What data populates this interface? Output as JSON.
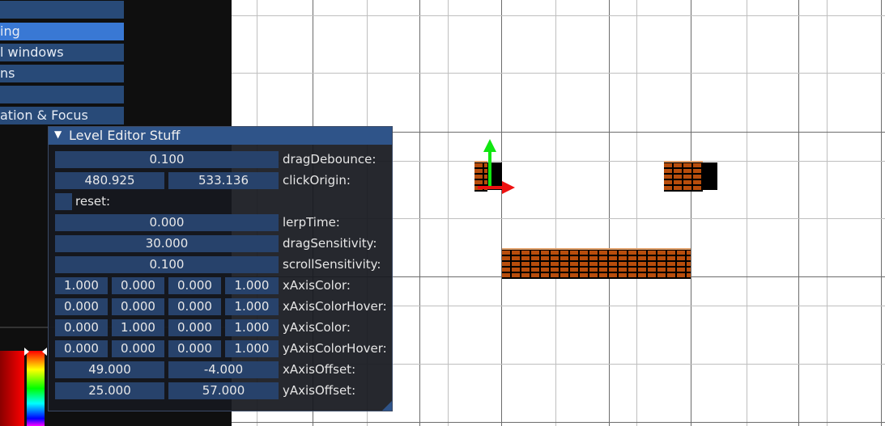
{
  "sidebar": {
    "items": [
      {
        "label": ""
      },
      {
        "label": "ing",
        "active": true
      },
      {
        "label": "l windows"
      },
      {
        "label": "ns"
      },
      {
        "label": ""
      },
      {
        "label": "ation & Focus"
      }
    ]
  },
  "editor": {
    "title": "Level Editor Stuff",
    "collapse_icon": "▼",
    "rows": {
      "dragDebounce": {
        "label": "dragDebounce:",
        "values": [
          "0.100"
        ]
      },
      "clickOrigin": {
        "label": "clickOrigin:",
        "values": [
          "480.925",
          "533.136"
        ]
      },
      "reset": {
        "label": "reset:",
        "checked": false
      },
      "lerpTime": {
        "label": "lerpTime:",
        "values": [
          "0.000"
        ]
      },
      "dragSensitivity": {
        "label": "dragSensitivity:",
        "values": [
          "30.000"
        ]
      },
      "scrollSensitivity": {
        "label": "scrollSensitivity:",
        "values": [
          "0.100"
        ]
      },
      "xAxisColor": {
        "label": "xAxisColor:",
        "values": [
          "1.000",
          "0.000",
          "0.000",
          "1.000"
        ]
      },
      "xAxisColorHover": {
        "label": "xAxisColorHover:",
        "values": [
          "0.000",
          "0.000",
          "0.000",
          "1.000"
        ]
      },
      "yAxisColor": {
        "label": "yAxisColor:",
        "values": [
          "0.000",
          "1.000",
          "0.000",
          "1.000"
        ]
      },
      "yAxisColorHover": {
        "label": "yAxisColorHover:",
        "values": [
          "0.000",
          "0.000",
          "0.000",
          "1.000"
        ]
      },
      "xAxisOffset": {
        "label": "xAxisOffset:",
        "values": [
          "49.000",
          "-4.000"
        ]
      },
      "yAxisOffset": {
        "label": "yAxisOffset:",
        "values": [
          "25.000",
          "57.000"
        ]
      }
    }
  },
  "colors": {
    "title_bar": "#2f5489",
    "field_bg": "#27426b",
    "nav_active": "#3978d4",
    "brick": "#b84d0c",
    "gizmo_x": "#ee1111",
    "gizmo_y": "#11e611"
  },
  "icons": [
    "collapse-arrow-icon",
    "resize-grip-icon",
    "gizmo-x-arrow-icon",
    "gizmo-y-arrow-icon"
  ]
}
